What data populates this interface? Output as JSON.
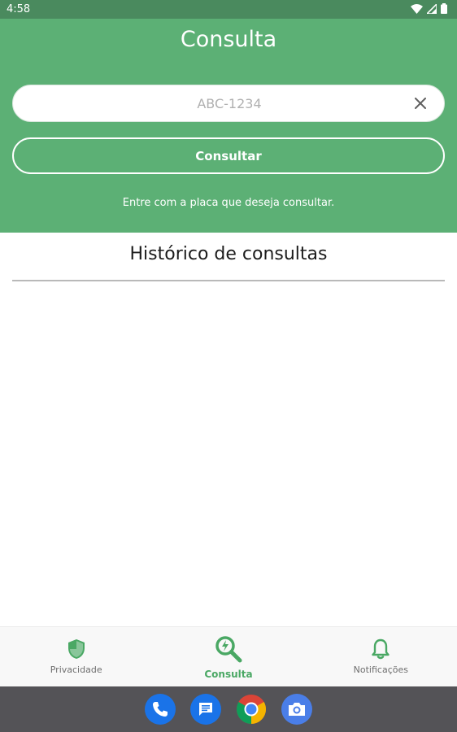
{
  "status_bar": {
    "time": "4:58",
    "icons": [
      "wifi-icon",
      "signal-icon",
      "battery-icon"
    ]
  },
  "header": {
    "title": "Consulta",
    "search": {
      "placeholder": "ABC-1234",
      "value": ""
    },
    "consult_button_label": "Consultar",
    "hint": "Entre com a placa que deseja consultar."
  },
  "history": {
    "title": "Histórico de consultas",
    "items": []
  },
  "bottom_nav": {
    "items": [
      {
        "label": "Privacidade",
        "icon": "shield-icon",
        "active": false
      },
      {
        "label": "Consulta",
        "icon": "search-bolt-icon",
        "active": true
      },
      {
        "label": "Notificações",
        "icon": "bell-icon",
        "active": false
      }
    ]
  },
  "dock": {
    "apps": [
      "phone-icon",
      "messages-icon",
      "chrome-icon",
      "camera-icon"
    ]
  },
  "colors": {
    "primary_green": "#5cb075",
    "status_bar": "#4a8a5e",
    "active_nav": "#4aa864",
    "dock": "#545357"
  }
}
